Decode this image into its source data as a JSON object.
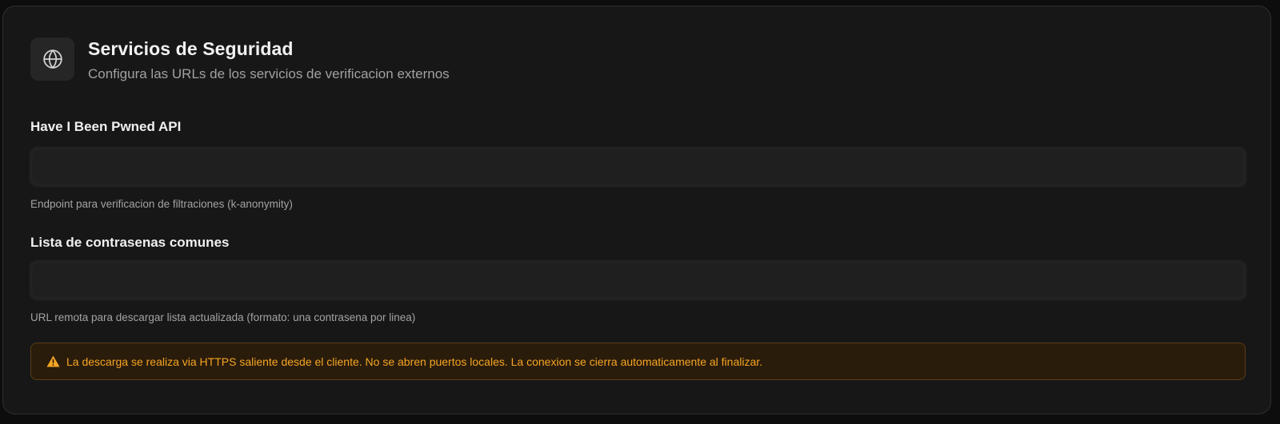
{
  "section": {
    "icon": "globe-icon",
    "title": "Servicios de Seguridad",
    "subtitle": "Configura las URLs de los servicios de verificacion externos"
  },
  "fields": {
    "hibp": {
      "label": "Have I Been Pwned API",
      "help": "Endpoint para verificacion de filtraciones (k-anonymity)"
    },
    "common_passwords": {
      "label": "Lista de contrasenas comunes",
      "help": "URL remota para descargar lista actualizada (formato: una contrasena por linea)"
    }
  },
  "warning": {
    "icon": "warning-triangle-icon",
    "text": "La descarga se realiza via HTTPS saliente desde el cliente. No se abren puertos locales. La conexion se cierra automaticamente al finalizar.",
    "color": "#f5a524"
  },
  "colors": {
    "card_bg": "#171717",
    "input_bg": "#1f1f1f",
    "warning_bg": "#2a1c0b"
  }
}
